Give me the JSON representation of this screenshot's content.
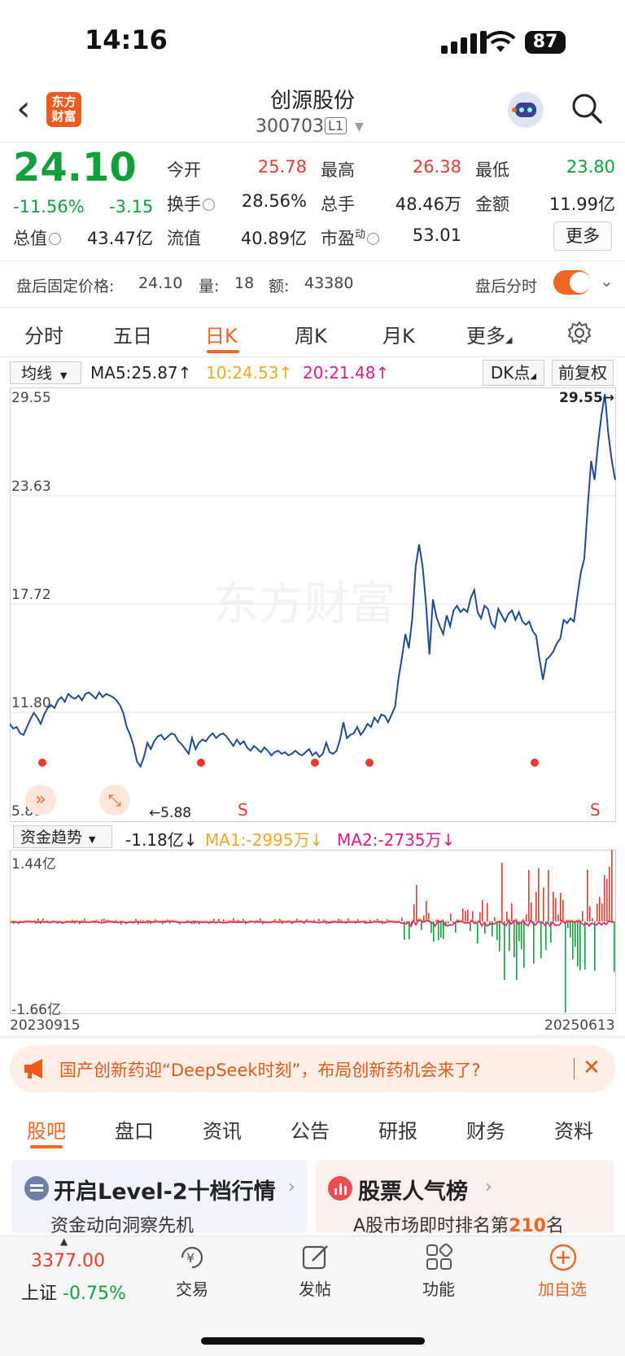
{
  "status": {
    "time": "14:16",
    "battery": "87"
  },
  "header": {
    "logo_text": "东方财富",
    "name": "创源股份",
    "code": "300703",
    "level": "L1"
  },
  "quote": {
    "price": "24.10",
    "change_pct": "-11.56%",
    "change": "-3.15",
    "open_label": "今开",
    "open": "25.78",
    "high_label": "最高",
    "high": "26.38",
    "low_label": "最低",
    "low": "23.80",
    "turnover_label": "换手",
    "turnover": "28.56%",
    "volume_label": "总手",
    "volume": "48.46万",
    "amount_label": "金额",
    "amount": "11.99亿",
    "mktcap_label": "总值",
    "mktcap": "43.47亿",
    "float_label": "流值",
    "float": "40.89亿",
    "pe_label": "市盈",
    "pe_sup": "动",
    "pe": "53.01",
    "more_label": "更多"
  },
  "after_hours": {
    "price_label": "盘后固定价格:",
    "price": "24.10",
    "vol_label": "量:",
    "vol": "18",
    "amt_label": "额:",
    "amt": "43380",
    "timeshare_label": "盘后分时"
  },
  "chart_tabs": [
    "分时",
    "五日",
    "日K",
    "周K",
    "月K",
    "更多",
    "settings"
  ],
  "active_chart_tab": "日K",
  "ma_row": {
    "select": "均线",
    "ma5": "MA5:25.87↑",
    "ma10": "10:24.53↑",
    "ma20": "20:21.48↑",
    "dk": "DK点",
    "adjust": "前复权"
  },
  "chart_data": [
    {
      "type": "line",
      "y_labels": [
        "29.55",
        "23.63",
        "17.72",
        "11.80",
        "5.88"
      ],
      "ylim": [
        5.88,
        29.55
      ],
      "max_annotation": "29.55→",
      "min_annotation": "←5.88",
      "signal_s": "S",
      "watermark": "东方财富",
      "values": [
        8.6,
        8.3,
        8.4,
        8.0,
        7.9,
        8.4,
        8.9,
        9.3,
        9.0,
        8.6,
        9.2,
        9.6,
        9.8,
        9.6,
        10.1,
        10.3,
        10.0,
        10.5,
        10.3,
        10.2,
        10.4,
        10.1,
        10.5,
        10.6,
        10.4,
        10.2,
        10.6,
        10.3,
        10.5,
        10.4,
        10.3,
        10.1,
        9.8,
        9.3,
        8.4,
        7.9,
        7.2,
        6.2,
        5.9,
        6.5,
        7.4,
        7.0,
        7.5,
        7.8,
        7.9,
        7.6,
        7.8,
        8.0,
        7.9,
        7.5,
        7.3,
        7.0,
        6.7,
        7.7,
        7.0,
        7.4,
        7.6,
        7.5,
        7.8,
        8.0,
        7.7,
        7.9,
        8.0,
        7.8,
        7.5,
        7.2,
        7.6,
        7.3,
        7.5,
        7.1,
        6.9,
        7.2,
        7.0,
        6.8,
        7.1,
        6.9,
        6.6,
        6.8,
        6.9,
        6.7,
        6.8,
        6.6,
        6.7,
        6.9,
        6.7,
        6.6,
        6.8,
        7.0,
        6.6,
        6.8,
        6.5,
        6.7,
        7.4,
        6.8,
        6.7,
        6.9,
        7.6,
        8.7,
        7.7,
        7.9,
        8.0,
        8.4,
        7.9,
        8.2,
        8.6,
        8.4,
        9.0,
        8.7,
        9.2,
        9.1,
        8.7,
        9.2,
        9.7,
        11.5,
        12.8,
        14.3,
        13.4,
        15.3,
        18.6,
        20.0,
        18.6,
        16.2,
        13.0,
        16.5,
        15.4,
        14.8,
        14.3,
        15.5,
        14.8,
        15.8,
        16.1,
        15.7,
        15.9,
        15.7,
        16.6,
        17.1,
        15.7,
        15.3,
        16.1,
        15.9,
        15.0,
        14.7,
        15.9,
        15.5,
        15.1,
        15.6,
        15.8,
        15.2,
        15.7,
        15.1,
        14.9,
        15.1,
        14.5,
        14.2,
        12.7,
        11.4,
        12.7,
        12.9,
        13.2,
        13.7,
        14.0,
        15.2,
        15.0,
        15.3,
        15.1,
        16.7,
        18.2,
        19.1,
        22.4,
        25.3,
        24.1,
        26.4,
        28.2,
        29.55,
        27.0,
        25.3,
        24.1
      ]
    },
    {
      "type": "bar",
      "y_labels": [
        "1.44亿",
        "-1.66亿"
      ],
      "ylim": [
        -1.66,
        1.44
      ],
      "x_labels": [
        "20230915",
        "20250613"
      ]
    }
  ],
  "fund_flow": {
    "select": "资金趋势",
    "value": "-1.18亿↓",
    "ma1": "MA1:-2995万↓",
    "ma2": "MA2:-2735万↓"
  },
  "news": {
    "text": "国产创新药迎“DeepSeek时刻”，布局创新药机会来了?"
  },
  "bottom_tabs": [
    "股吧",
    "盘口",
    "资讯",
    "公告",
    "研报",
    "财务",
    "资料"
  ],
  "cards": [
    {
      "title": "开启Level-2十档行情",
      "sub": "资金动向洞察先机"
    },
    {
      "title": "股票人气榜",
      "sub_pre": "A股市场即时排名第",
      "rank": "210",
      "sub_post": "名"
    }
  ],
  "bottom_nav": {
    "index_value": "3377.00",
    "index_name": "上证",
    "index_change": "-0.75%",
    "trade": "交易",
    "post": "发帖",
    "func": "功能",
    "add": "加自选"
  }
}
